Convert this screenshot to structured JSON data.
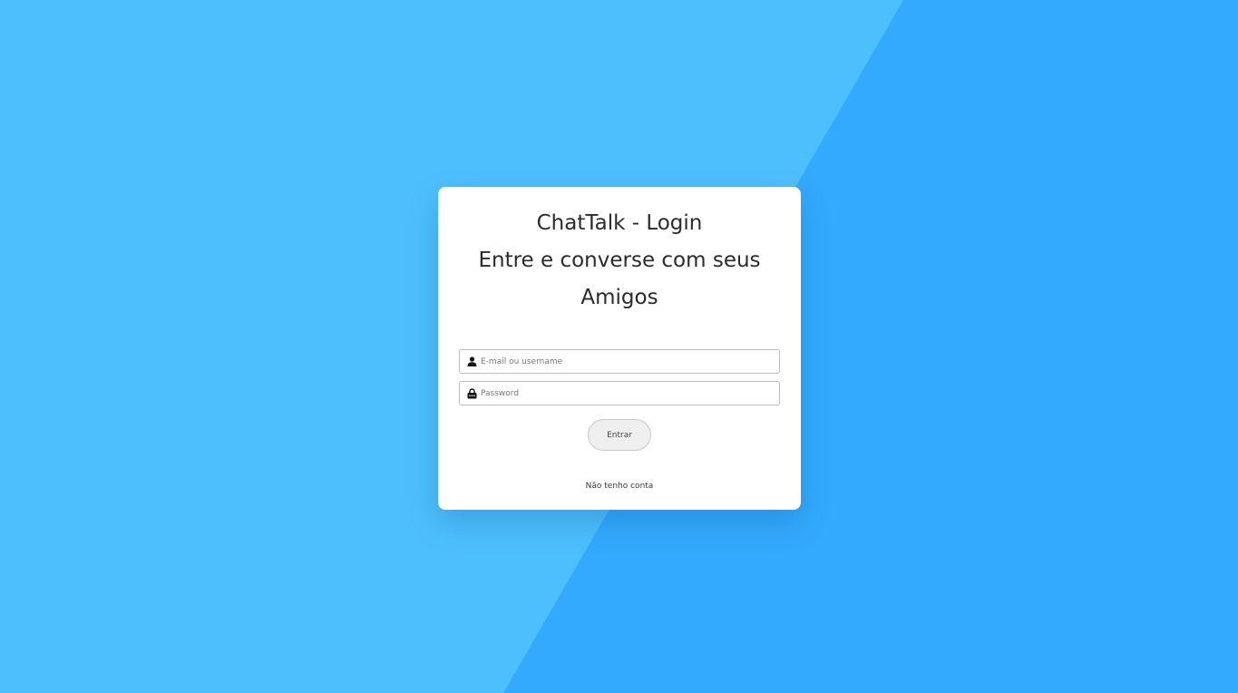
{
  "login": {
    "title": "ChatTalk - Login",
    "subtitle": "Entre e converse com seus Amigos",
    "email_field": {
      "placeholder": "E-mail ou username",
      "value": "",
      "icon": "user-icon"
    },
    "password_field": {
      "placeholder": "Password",
      "value": "",
      "icon": "lock-icon"
    },
    "submit_label": "Entrar",
    "signup_link": "Não tenho conta"
  },
  "colors": {
    "background_light": "#4ebffd",
    "background_dark": "#33aafd",
    "card": "#ffffff",
    "text": "#2b2b2b"
  }
}
